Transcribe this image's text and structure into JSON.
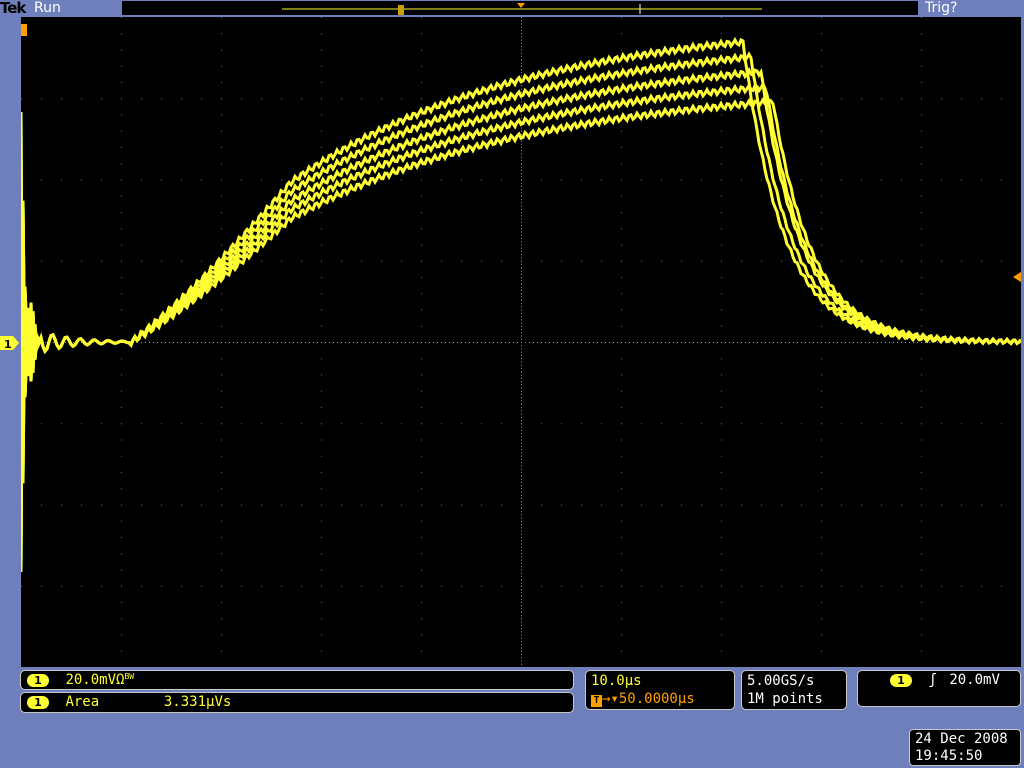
{
  "header": {
    "brand": "Tek",
    "state": "Run",
    "trigger_status": "Trig?"
  },
  "channel": {
    "number": "1",
    "scale": "20.0mV",
    "coupling_symbol": "Ω",
    "bw_symbol": "BW"
  },
  "measurement": {
    "channel": "1",
    "name": "Area",
    "value": "3.331µVs"
  },
  "timebase": {
    "scale": "10.0µs",
    "position": "50.0000µs"
  },
  "acquisition": {
    "sample_rate": "5.00GS/s",
    "record_length": "1M points"
  },
  "trigger": {
    "channel": "1",
    "slope_symbol": "rising-edge-icon",
    "level": "20.0mV"
  },
  "datetime": {
    "date": "24 Dec 2008",
    "time": "19:45:50"
  },
  "colors": {
    "trace": "#ffff33",
    "frame": "#6f7fbc",
    "background": "#000000",
    "graticule": "#8a8a8a"
  }
}
